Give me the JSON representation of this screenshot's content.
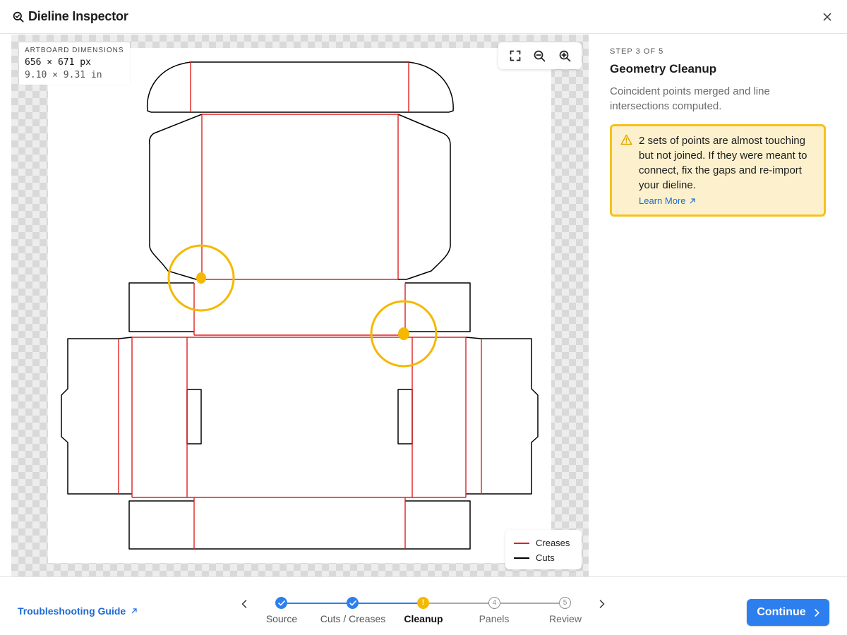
{
  "header": {
    "title": "Dieline Inspector",
    "title_icon": "search-check-icon",
    "close_icon": "close-icon"
  },
  "artboard": {
    "dimensions_label": "ARTBOARD DIMENSIONS",
    "pixels": "656 × 671 px",
    "inches": "9.10 × 9.31 in"
  },
  "zoom_controls": [
    {
      "name": "fit-to-screen-icon"
    },
    {
      "name": "zoom-out-icon"
    },
    {
      "name": "zoom-in-icon"
    }
  ],
  "legend": {
    "items": [
      {
        "label": "Creases",
        "color": "#e02020"
      },
      {
        "label": "Cuts",
        "color": "#000000"
      }
    ]
  },
  "panel": {
    "step": "STEP 3 OF 5",
    "heading": "Geometry Cleanup",
    "description": "Coincident points merged and line intersections computed.",
    "warning": {
      "text": "2 sets of points are almost touching but not joined. If they were meant to connect, fix the gaps and re-import your dieline.",
      "link": "Learn More",
      "border_color": "#f5c21b",
      "background": "#fdf1cd"
    }
  },
  "footer": {
    "troubleshooting": "Troubleshooting Guide",
    "steps": [
      {
        "label": "Source",
        "status": "done"
      },
      {
        "label": "Cuts / Creases",
        "status": "done"
      },
      {
        "label": "Cleanup",
        "status": "warning"
      },
      {
        "label": "Panels",
        "status": "pending",
        "number": "4"
      },
      {
        "label": "Review",
        "status": "pending",
        "number": "5"
      }
    ],
    "continue_label": "Continue"
  },
  "colors": {
    "accent": "#2d7ff0",
    "link": "#1d6ad3",
    "warning": "#f5b800",
    "crease": "#e02020",
    "cut": "#000000"
  }
}
